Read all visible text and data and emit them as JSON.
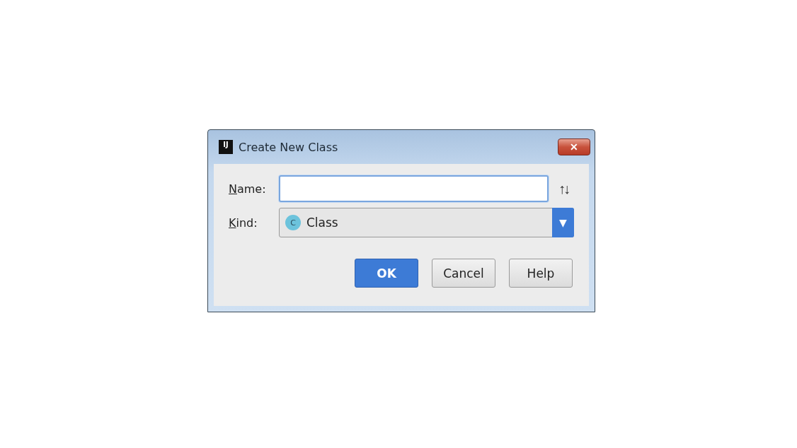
{
  "window": {
    "title": "Create New Class",
    "logo": "IJ",
    "close_glyph": "✕"
  },
  "name_field": {
    "label": "Name:",
    "mnemonic_underlined": true,
    "focused": true,
    "sort_glyph": "↑↓"
  },
  "kind_field": {
    "label": "Kind:",
    "mnemonic_underlined": true,
    "icon_letter": "C",
    "value": "Class",
    "arrow_glyph": "▼"
  },
  "buttons": [
    {
      "label": "OK",
      "default": true
    },
    {
      "label": "Cancel",
      "default": false
    },
    {
      "label": "Help",
      "default": false
    }
  ]
}
